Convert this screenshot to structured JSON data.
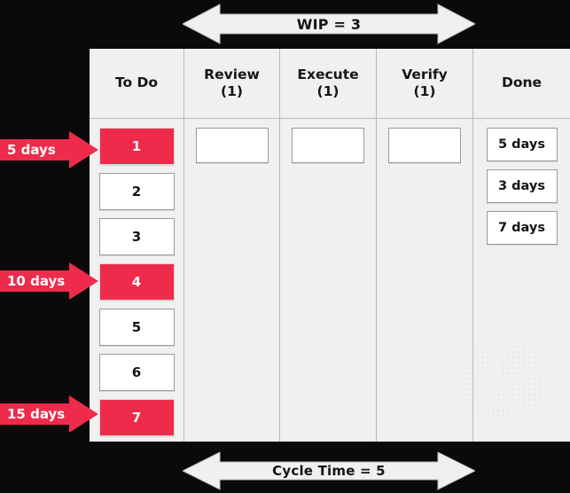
{
  "diagram": {
    "title_top": "WIP = 3",
    "title_bottom": "Cycle Time = 5",
    "colors": {
      "board_background": "#f0f0f0",
      "page_background": "#0a0a0a",
      "accent_red": "#ef2b4b",
      "card_white": "#ffffff",
      "border_gray": "#9a9a9a",
      "text_dark": "#141414",
      "arrow_white": "#f0f0f0"
    }
  },
  "top_arrow": {
    "label": "WIP = 3",
    "icon": "double-headed-arrow-icon",
    "direction": "horizontal"
  },
  "bottom_arrow": {
    "label": "Cycle Time = 5",
    "icon": "double-headed-arrow-icon",
    "direction": "horizontal"
  },
  "columns": [
    {
      "key": "todo",
      "title": "To Do",
      "count": "",
      "has_count": false
    },
    {
      "key": "review",
      "title": "Review",
      "count": "(1)",
      "has_count": true
    },
    {
      "key": "execute",
      "title": "Execute",
      "count": "(1)",
      "has_count": true
    },
    {
      "key": "verify",
      "title": "Verify",
      "count": "(1)",
      "has_count": true
    },
    {
      "key": "done",
      "title": "Done",
      "count": "",
      "has_count": false
    }
  ],
  "cards": {
    "todo": [
      {
        "label": "1",
        "highlight": true
      },
      {
        "label": "2",
        "highlight": false
      },
      {
        "label": "3",
        "highlight": false
      },
      {
        "label": "4",
        "highlight": true
      },
      {
        "label": "5",
        "highlight": false
      },
      {
        "label": "6",
        "highlight": false
      },
      {
        "label": "7",
        "highlight": true
      }
    ],
    "review": [
      {
        "label": "",
        "highlight": false
      }
    ],
    "execute": [
      {
        "label": "",
        "highlight": false
      }
    ],
    "verify": [
      {
        "label": "",
        "highlight": false
      }
    ],
    "done": [
      {
        "label": "5 days",
        "highlight": false
      },
      {
        "label": "3 days",
        "highlight": false
      },
      {
        "label": "7 days",
        "highlight": false
      }
    ]
  },
  "day_arrows": [
    {
      "label": "5 days",
      "target_card": "1"
    },
    {
      "label": "10 days",
      "target_card": "4"
    },
    {
      "label": "15 days",
      "target_card": "7"
    }
  ],
  "watermark": {
    "icon": "k-logo-watermark"
  }
}
